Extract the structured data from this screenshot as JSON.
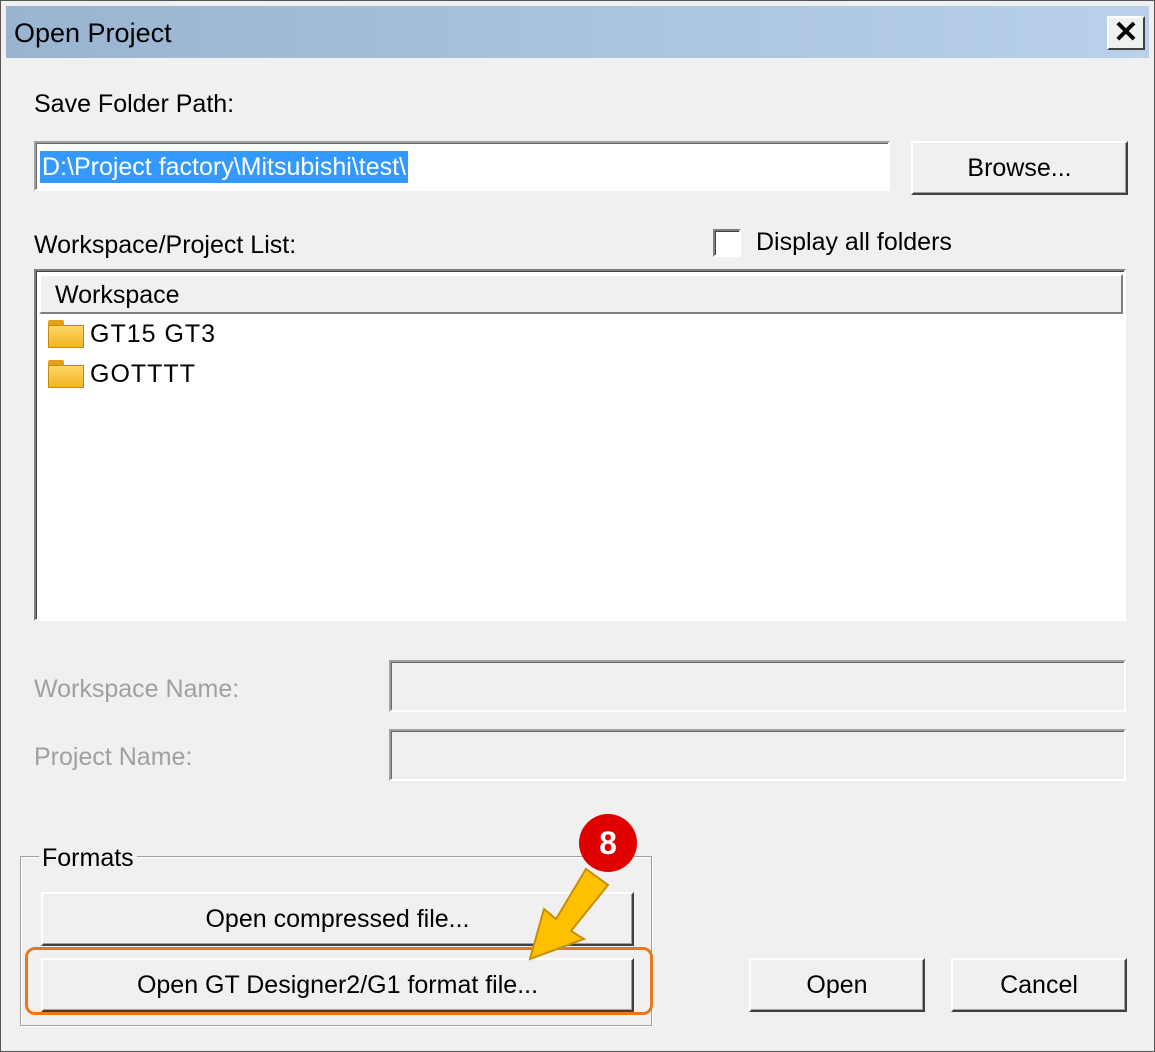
{
  "window": {
    "title": "Open Project",
    "close_label": "✕"
  },
  "save_folder": {
    "label": "Save Folder Path:",
    "value": "D:\\Project factory\\Mitsubishi\\test\\",
    "browse_label": "Browse..."
  },
  "workspace_list": {
    "label": "Workspace/Project List:",
    "display_all_label": "Display all folders",
    "display_all_checked": false,
    "column_header": "Workspace",
    "items": [
      {
        "label": "GT15 GT3",
        "icon": "folder-icon"
      },
      {
        "label": "GOTTTT",
        "icon": "folder-icon"
      }
    ]
  },
  "fields": {
    "workspace_name_label": "Workspace Name:",
    "project_name_label": "Project Name:"
  },
  "formats": {
    "group_label": "Formats",
    "open_compressed_label": "Open compressed file...",
    "open_gt_designer_label": "Open GT Designer2/G1 format file..."
  },
  "buttons": {
    "open_label": "Open",
    "cancel_label": "Cancel"
  },
  "annotation": {
    "step_number": "8",
    "badge_color": "#e00000",
    "arrow_color": "#ffc000",
    "highlight_color": "#e8781e"
  }
}
